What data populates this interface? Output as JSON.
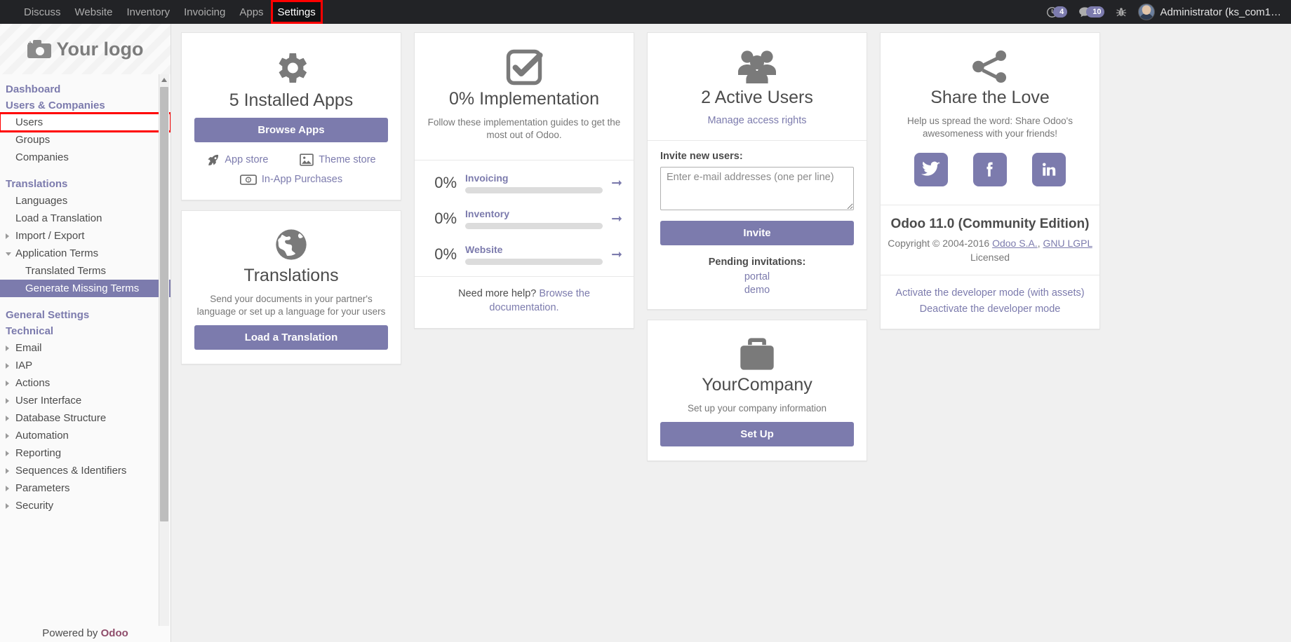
{
  "topbar": {
    "menu_items": [
      {
        "label": "Discuss",
        "active": false
      },
      {
        "label": "Website",
        "active": false
      },
      {
        "label": "Inventory",
        "active": false
      },
      {
        "label": "Invoicing",
        "active": false
      },
      {
        "label": "Apps",
        "active": false
      },
      {
        "label": "Settings",
        "active": true
      }
    ],
    "activities_count": "4",
    "messages_count": "10",
    "debug_icon": "bug-icon",
    "user_name": "Administrator (ks_com1…"
  },
  "sidebar": {
    "logo_text": "Your logo",
    "items": [
      {
        "label": "Dashboard",
        "type": "section"
      },
      {
        "label": "Users & Companies",
        "type": "section"
      },
      {
        "label": "Users",
        "type": "link",
        "state": "highlighted"
      },
      {
        "label": "Groups",
        "type": "link"
      },
      {
        "label": "Companies",
        "type": "link"
      },
      {
        "label": "Translations",
        "type": "section",
        "spaced": true
      },
      {
        "label": "Languages",
        "type": "link"
      },
      {
        "label": "Load a Translation",
        "type": "link"
      },
      {
        "label": "Import / Export",
        "type": "link",
        "caret": "closed"
      },
      {
        "label": "Application Terms",
        "type": "link",
        "caret": "open"
      },
      {
        "label": "Translated Terms",
        "type": "link",
        "deep": true
      },
      {
        "label": "Generate Missing Terms",
        "type": "link",
        "deep": true,
        "state": "selected"
      },
      {
        "label": "General Settings",
        "type": "section",
        "spaced": true
      },
      {
        "label": "Technical",
        "type": "section"
      },
      {
        "label": "Email",
        "type": "link",
        "caret": "closed"
      },
      {
        "label": "IAP",
        "type": "link",
        "caret": "closed"
      },
      {
        "label": "Actions",
        "type": "link",
        "caret": "closed"
      },
      {
        "label": "User Interface",
        "type": "link",
        "caret": "closed"
      },
      {
        "label": "Database Structure",
        "type": "link",
        "caret": "closed"
      },
      {
        "label": "Automation",
        "type": "link",
        "caret": "closed"
      },
      {
        "label": "Reporting",
        "type": "link",
        "caret": "closed"
      },
      {
        "label": "Sequences & Identifiers",
        "type": "link",
        "caret": "closed"
      },
      {
        "label": "Parameters",
        "type": "link",
        "caret": "closed"
      },
      {
        "label": "Security",
        "type": "link",
        "caret": "closed"
      }
    ],
    "powered_by_prefix": "Powered by ",
    "powered_by_brand": "Odoo"
  },
  "apps_card": {
    "icon": "gear-icon",
    "title": "5 Installed Apps",
    "browse_button": "Browse Apps",
    "links": [
      {
        "label": "App store",
        "icon": "rocket-icon"
      },
      {
        "label": "Theme store",
        "icon": "image-icon"
      },
      {
        "label": "In-App Purchases",
        "icon": "money-icon"
      }
    ]
  },
  "translations_card": {
    "icon": "globe-icon",
    "title": "Translations",
    "description": "Send your documents in your partner's language or set up a language for your users",
    "button": "Load a Translation"
  },
  "implementation_card": {
    "icon": "check-square-icon",
    "title": "0% Implementation",
    "description": "Follow these implementation guides to get the most out of Odoo.",
    "guides": [
      {
        "percent": "0%",
        "name": "Invoicing",
        "value": 0
      },
      {
        "percent": "0%",
        "name": "Inventory",
        "value": 0
      },
      {
        "percent": "0%",
        "name": "Website",
        "value": 0
      }
    ],
    "help_prefix": "Need more help? ",
    "help_link": "Browse the documentation."
  },
  "users_card": {
    "icon": "users-icon",
    "title": "2 Active Users",
    "manage_link": "Manage access rights",
    "invite_label": "Invite new users:",
    "invite_placeholder": "Enter e-mail addresses (one per line)",
    "invite_value": "",
    "invite_button": "Invite",
    "pending_title": "Pending invitations:",
    "pending": [
      "portal",
      "demo"
    ]
  },
  "company_card": {
    "icon": "briefcase-icon",
    "title": "YourCompany",
    "description": "Set up your company information",
    "button": "Set Up"
  },
  "share_card": {
    "icon": "share-icon",
    "title": "Share the Love",
    "description": "Help us spread the word: Share Odoo's awesomeness with your friends!",
    "socials": [
      {
        "name": "twitter-icon"
      },
      {
        "name": "facebook-icon"
      },
      {
        "name": "linkedin-icon"
      }
    ],
    "version": "Odoo 11.0 (Community Edition)",
    "copyright_prefix": "Copyright © 2004-2016 ",
    "copyright_link1": "Odoo S.A.",
    "copyright_sep": ", ",
    "copyright_link2": "GNU LGPL",
    "copyright_suffix": " Licensed",
    "dev_links": [
      "Activate the developer mode (with assets)",
      "Deactivate the developer mode"
    ]
  },
  "colors": {
    "accent": "#7c7bad",
    "navbar": "#222326",
    "highlight": "#ff0000"
  }
}
